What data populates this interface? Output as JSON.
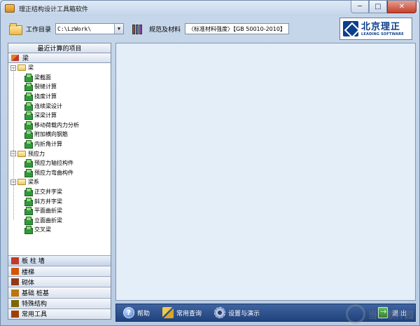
{
  "window": {
    "title": "理正结构设计工具箱软件",
    "min_label": "─",
    "max_label": "□",
    "close_label": "✕"
  },
  "toolbar": {
    "workdir_label": "工作目录",
    "workdir_value": "C:\\LzWork\\",
    "standard_label": "规范及材料",
    "standard_value": "〈标准材料强度〉【GB 50010-2010】"
  },
  "logo": {
    "cn": "北京理正",
    "en": "LEADING SOFTWARE"
  },
  "left_panel": {
    "recent_label": "最近计算的项目",
    "category_label": "梁",
    "tree": [
      {
        "type": "folder",
        "label": "梁",
        "expander": "−"
      },
      {
        "type": "leaf",
        "label": "梁截面"
      },
      {
        "type": "leaf",
        "label": "裂缝计算"
      },
      {
        "type": "leaf",
        "label": "挠度计算"
      },
      {
        "type": "leaf",
        "label": "连续梁设计"
      },
      {
        "type": "leaf",
        "label": "深梁计算"
      },
      {
        "type": "leaf",
        "label": "移动荷载内力分析"
      },
      {
        "type": "leaf",
        "label": "附加横向钢筋"
      },
      {
        "type": "leaf",
        "label": "内折角计算"
      },
      {
        "type": "folder",
        "label": "预应力",
        "expander": "−"
      },
      {
        "type": "leaf",
        "label": "预应力轴拉构件"
      },
      {
        "type": "leaf",
        "label": "预应力弯曲构件"
      },
      {
        "type": "folder",
        "label": "梁系",
        "expander": "−"
      },
      {
        "type": "leaf",
        "label": "正交井字梁"
      },
      {
        "type": "leaf",
        "label": "斜方井字梁"
      },
      {
        "type": "leaf",
        "label": "平面曲折梁"
      },
      {
        "type": "leaf",
        "label": "立面曲折梁"
      },
      {
        "type": "leaf",
        "label": "交叉梁"
      }
    ],
    "bottom_categories": [
      {
        "label": "板 柱 墙",
        "color": "#c0392b"
      },
      {
        "label": "楼梯",
        "color": "#d35400"
      },
      {
        "label": "砌体",
        "color": "#8e3a1a"
      },
      {
        "label": "基础 桩基",
        "color": "#b9770e"
      },
      {
        "label": "特殊结构",
        "color": "#7d6608"
      },
      {
        "label": "常用工具",
        "color": "#a04000"
      }
    ]
  },
  "bottom_bar": {
    "help_label": "帮助",
    "lookup_label": "常用查询",
    "settings_label": "设置与演示",
    "exit_label": "退 出"
  },
  "watermark": {
    "text": "当下软件园"
  }
}
